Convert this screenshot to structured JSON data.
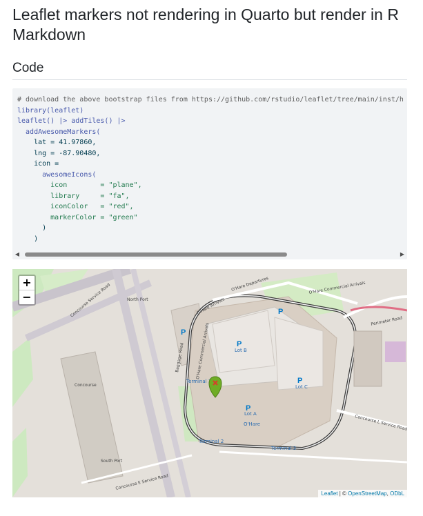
{
  "page": {
    "title": "Leaflet markers not rendering in Quarto but render in R Markdown",
    "section_heading": "Code"
  },
  "code": {
    "lines": [
      "# download the above bootstrap files from https://github.com/rstudio/leaflet/tree/main/inst/htmlwidgets/plugins/Leaflet.awesome-markers",
      "library(leaflet)",
      "leaflet() |> addTiles() |>",
      "  addAwesomeMarkers(",
      "    lat = 41.97860,",
      "    lng = -87.90480,",
      "    icon =",
      "      awesomeIcons(",
      "        icon        = \"plane\",",
      "        library     = \"fa\",",
      "        iconColor   = \"red\",",
      "        markerColor = \"green\"",
      "      )",
      "    )"
    ]
  },
  "map": {
    "zoom_in_label": "+",
    "zoom_out_label": "−",
    "labels": {
      "ohare_departures": "O'Hare Departures",
      "ohare_arrivals": "O'Hare Arrivals",
      "ohare_commercial_arrivals": "O'Hare Commercial Arrivals",
      "perimeter_road": "Perimeter Road",
      "concourse_service_road": "Concourse Service Road",
      "north_port": "North Port",
      "concourse": "Concourse",
      "baggage_road": "Baggage Road",
      "lot_b": "Lot B",
      "lot_c": "Lot C",
      "lot_a": "Lot A",
      "terminal_1": "Terminal 1",
      "terminal_2": "Terminal 2",
      "terminal_3": "Terminal 3",
      "ohare_station": "O'Hare",
      "south_port": "South Port",
      "concourse_l_service_road": "Concourse L Service Road",
      "concourse_e_service_road": "Concourse E Service Road",
      "parking_symbol": "P"
    },
    "attribution": {
      "leaflet": "Leaflet",
      "separator": " | © ",
      "osm": "OpenStreetMap",
      "comma": ", ",
      "odbl": "ODbL"
    },
    "marker": {
      "marker_color": "green",
      "icon_color": "red",
      "icon": "plane-icon"
    }
  }
}
